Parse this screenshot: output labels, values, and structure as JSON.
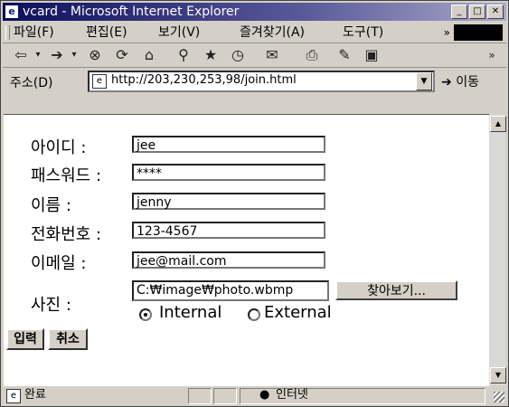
{
  "window": {
    "title": "vcard - Microsoft Internet Explorer",
    "app_icon": "e"
  },
  "menu": [
    "파일(F)",
    "편집(E)",
    "보기(V)",
    "즐겨찾기(A)",
    "도구(T)"
  ],
  "menu_more": "»",
  "address": {
    "label": "주소(D)",
    "url": "http://203,230,253,98/join.html",
    "go_label": "이동"
  },
  "form": {
    "id_label": "아이디 :",
    "id_value": "jee",
    "password_label": "패스워드 :",
    "password_value": "****",
    "name_label": "이름 :",
    "name_value": "jenny",
    "phone_label": "전화번호 :",
    "phone_value": "123-4567",
    "email_label": "이메일 :",
    "email_value": "jee@mail.com",
    "photo_label": "사진 :",
    "photo_value": "C:₩image₩photo.wbmp",
    "browse_label": "찾아보기...",
    "radio_internal": "Internal",
    "radio_external": "External",
    "selected_radio": "Internal",
    "submit_label": "입력",
    "cancel_label": "취소"
  },
  "status": {
    "text": "완료",
    "zone": "인터넷"
  },
  "icons": [
    "back-icon",
    "forward-icon",
    "stop-icon",
    "refresh-icon",
    "home-icon",
    "search-icon",
    "favorites-icon",
    "history-icon",
    "mail-icon",
    "print-icon",
    "edit-icon"
  ]
}
